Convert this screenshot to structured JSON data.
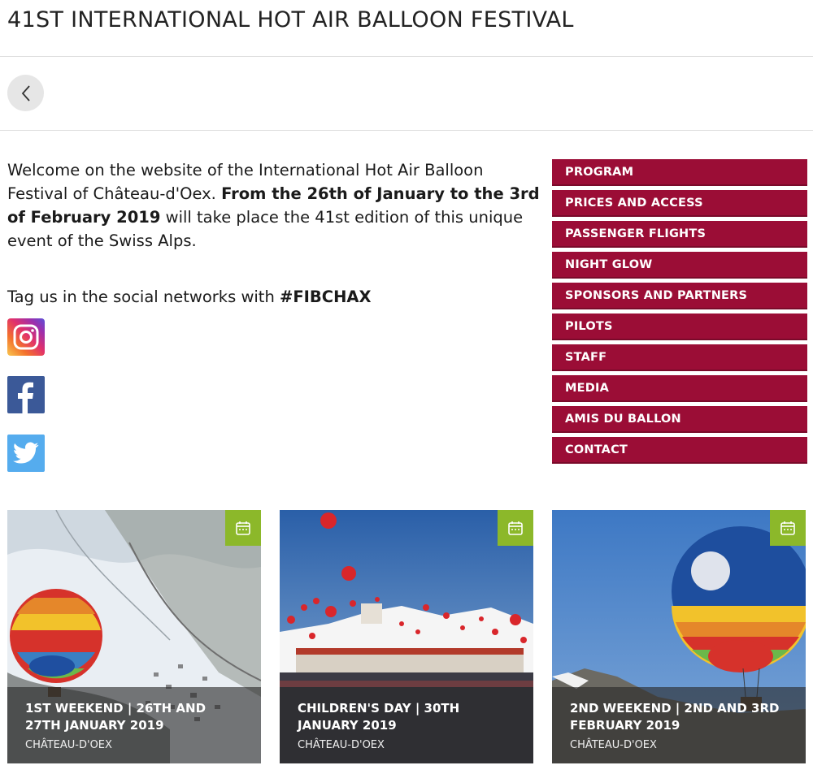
{
  "header": {
    "title": "41ST INTERNATIONAL HOT AIR BALLOON FESTIVAL"
  },
  "nav": {
    "back_icon": "chevron-left-icon"
  },
  "intro": {
    "text_1": "Welcome on the website of the International Hot Air Balloon Festival of Château-d'Oex. ",
    "text_bold": "From the 26th of January to the 3rd of February 2019",
    "text_2": " will take place the 41st edition of this unique event of the Swiss Alps."
  },
  "tagline": {
    "text": "Tag us in the social networks with ",
    "hashtag": "#FIBCHAX"
  },
  "social": [
    {
      "icon": "instagram-icon"
    },
    {
      "icon": "facebook-icon"
    },
    {
      "icon": "twitter-icon"
    }
  ],
  "menu": {
    "items": [
      {
        "label": "PROGRAM"
      },
      {
        "label": "PRICES AND ACCESS"
      },
      {
        "label": "PASSENGER FLIGHTS"
      },
      {
        "label": "NIGHT GLOW"
      },
      {
        "label": "SPONSORS AND PARTNERS"
      },
      {
        "label": "PILOTS"
      },
      {
        "label": "STAFF"
      },
      {
        "label": "MEDIA"
      },
      {
        "label": "AMIS DU BALLON"
      },
      {
        "label": "CONTACT"
      }
    ]
  },
  "events": [
    {
      "title": "1ST WEEKEND | 26TH AND 27TH JANUARY 2019",
      "location": "CHÂTEAU-D'OEX",
      "badge_icon": "calendar-icon"
    },
    {
      "title": "CHILDREN'S DAY | 30TH JANUARY 2019",
      "location": "CHÂTEAU-D'OEX",
      "badge_icon": "calendar-icon"
    },
    {
      "title": "2ND WEEKEND | 2ND AND 3RD FEBRUARY 2019",
      "location": "CHÂTEAU-D'OEX",
      "badge_icon": "calendar-icon"
    }
  ],
  "colors": {
    "menu_bg": "#9b0d36",
    "badge_bg": "#8cb82a"
  }
}
